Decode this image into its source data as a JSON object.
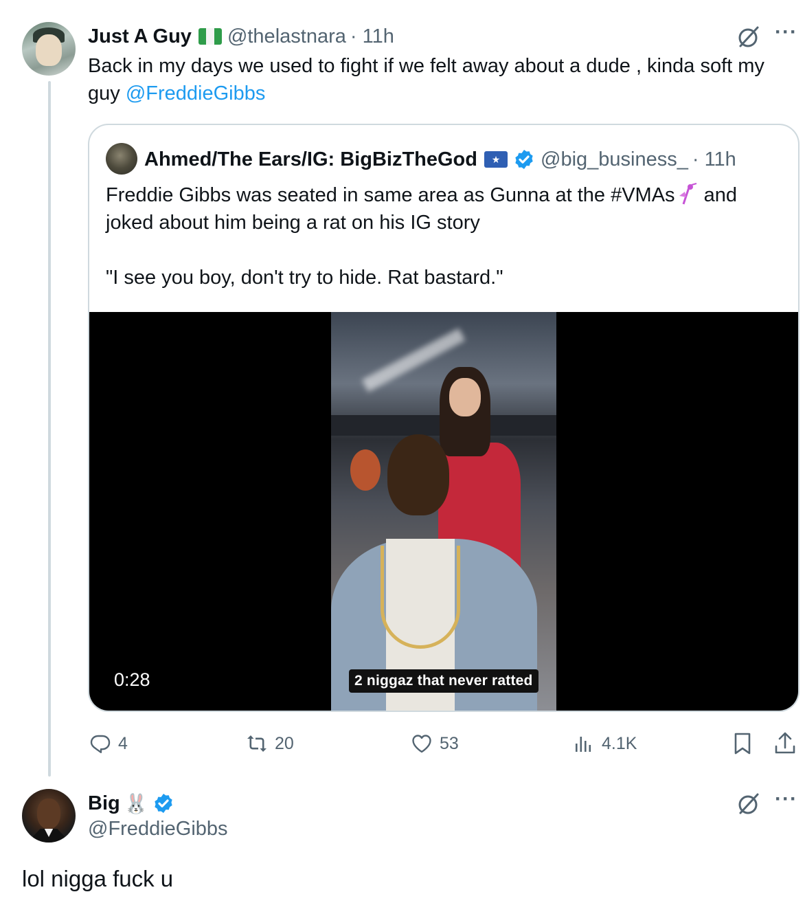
{
  "tweet": {
    "author_name": "Just A Guy",
    "author_handle": "@thelastnara",
    "time": "· 11h",
    "text_plain": "Back in my days we used to fight if we felt away about a dude , kinda soft my guy ",
    "text_mention": "@FreddieGibbs"
  },
  "quote": {
    "author_name": "Ahmed/The Ears/IG: BigBizTheGod",
    "author_handle": "@big_business_",
    "time": "· 11h",
    "line1_a": "Freddie Gibbs was seated in same area as Gunna at the #VMAs",
    "line1_b": " and",
    "line2": "joked about him being a rat on his IG story",
    "line3": "",
    "line4": "\"I see you boy, don't try to hide. Rat bastard.\"",
    "video": {
      "duration": "0:28",
      "caption": "2 niggaz that never ratted"
    }
  },
  "actions": {
    "replies": "4",
    "reposts": "20",
    "likes": "53",
    "views": "4.1K"
  },
  "reply": {
    "author_name": "Big",
    "author_emoji": "🐰",
    "author_handle": "@FreddieGibbs",
    "text": "lol nigga fuck u"
  },
  "colors": {
    "link": "#1d9bf0",
    "muted": "#536471",
    "verified": "#1d9bf0",
    "border": "#cfd9de"
  },
  "icons": [
    "grok-icon",
    "more-icon",
    "verified-badge-icon",
    "reply-icon",
    "repost-icon",
    "like-icon",
    "views-icon",
    "bookmark-icon",
    "share-icon"
  ]
}
